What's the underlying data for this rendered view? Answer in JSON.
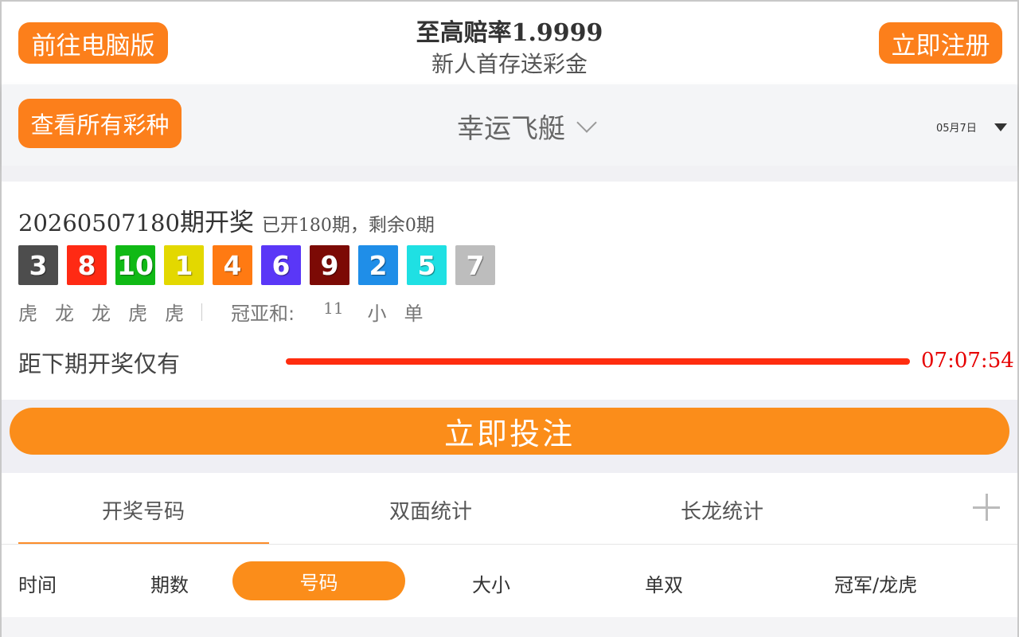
{
  "header": {
    "pc_button": "前往电脑版",
    "register_button": "立即注册",
    "title_prefix": "至高赔率",
    "title_number": "1.9999",
    "subtitle": "新人首存送彩金"
  },
  "gamebar": {
    "all_games_button": "查看所有彩种",
    "game_name": "幸运飞艇",
    "date": "05月7日"
  },
  "result": {
    "issue_number": "20260507180",
    "issue_suffix": "期开奖",
    "opened_prefix": "已开",
    "opened_count": "180",
    "opened_mid": "期，剩余",
    "remaining_count": "0",
    "remaining_suffix": "期",
    "balls": [
      {
        "value": "3",
        "color": "#4d4d4d"
      },
      {
        "value": "8",
        "color": "#ff2a14"
      },
      {
        "value": "10",
        "color": "#10b915"
      },
      {
        "value": "1",
        "color": "#e3d800"
      },
      {
        "value": "4",
        "color": "#ff7a12"
      },
      {
        "value": "6",
        "color": "#5a37f7"
      },
      {
        "value": "9",
        "color": "#7c0a05"
      },
      {
        "value": "2",
        "color": "#1f8ee8"
      },
      {
        "value": "5",
        "color": "#1fe0e3"
      },
      {
        "value": "7",
        "color": "#bdbdbd"
      }
    ],
    "dragon_tiger": [
      "虎",
      "龙",
      "龙",
      "虎",
      "虎"
    ],
    "gyh_label": "冠亚和:",
    "gyh_sum": "11",
    "gyh_size": "小",
    "gyh_parity": "单",
    "countdown_label": "距下期开奖仅有",
    "countdown_time": "07:07:54"
  },
  "bet_button": "立即投注",
  "tabs": [
    {
      "label": "开奖号码",
      "active": true
    },
    {
      "label": "双面统计",
      "active": false
    },
    {
      "label": "长龙统计",
      "active": false
    }
  ],
  "columns": {
    "time": "时间",
    "issue": "期数",
    "numbers": "号码",
    "size": "大小",
    "parity": "单双",
    "champion": "冠军/龙虎"
  },
  "colors": {
    "accent": "#fb8d1a",
    "countdown": "#e60000"
  }
}
